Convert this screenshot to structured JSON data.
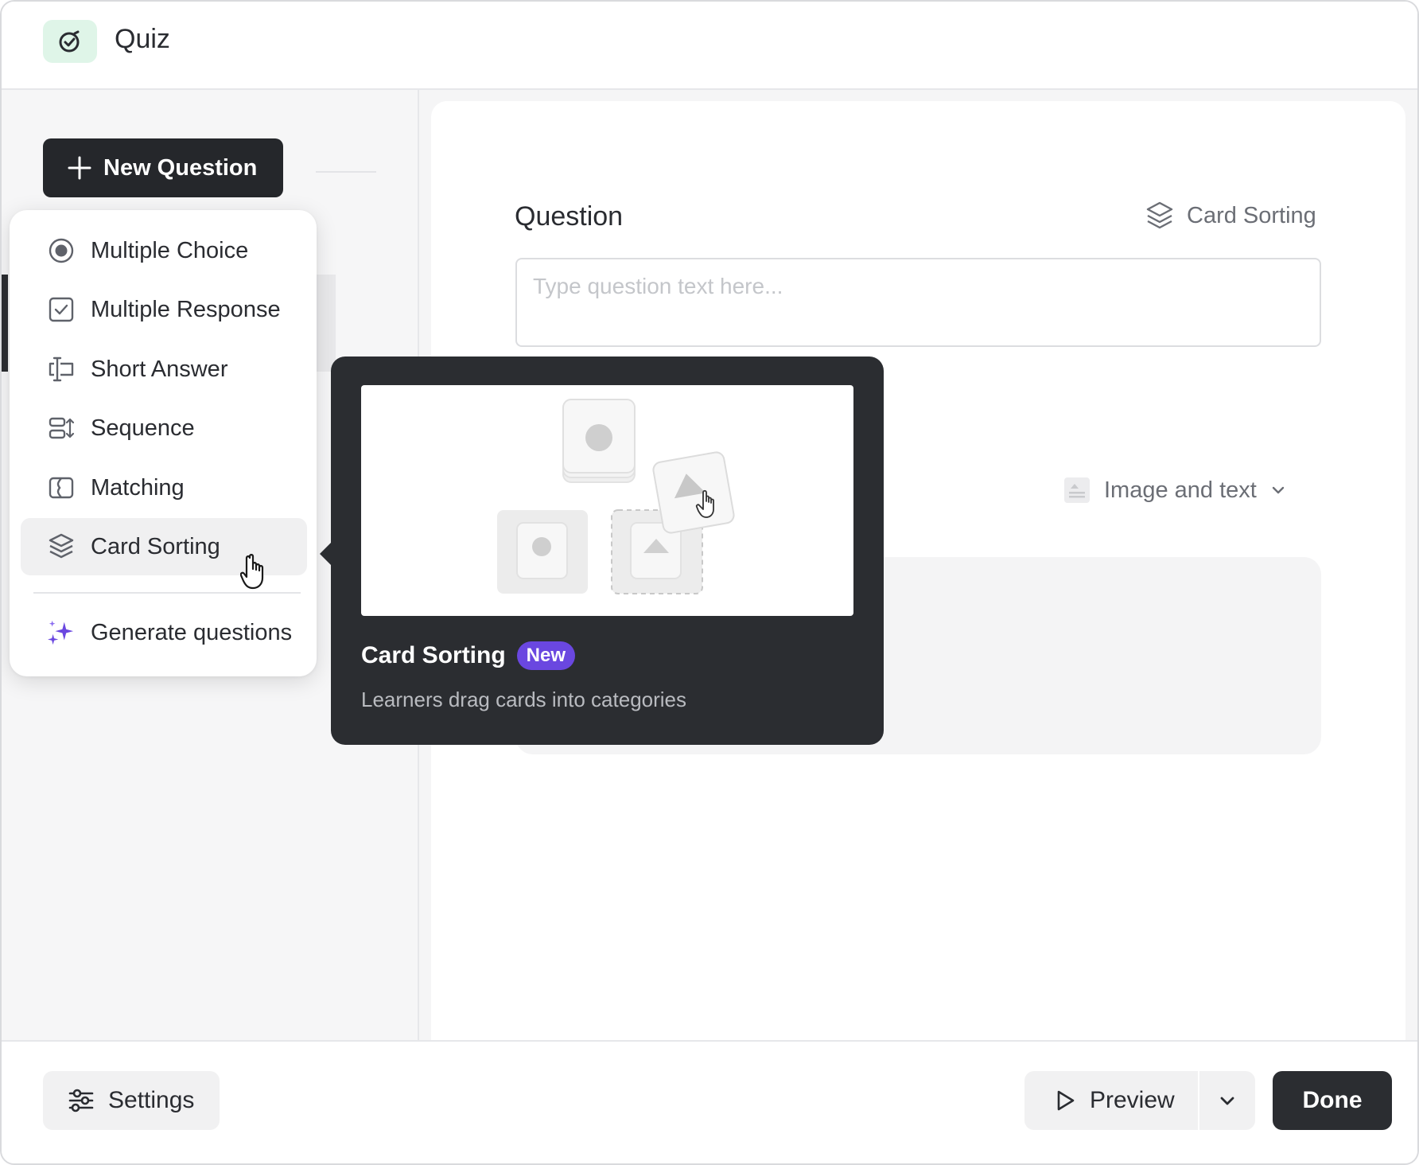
{
  "app": {
    "title": "Quiz",
    "icon": "check-circle-icon",
    "accent_badge_color": "#dff5e8"
  },
  "sidebar": {
    "new_question_label": "New Question"
  },
  "menu": {
    "items": [
      {
        "label": "Multiple Choice",
        "icon": "radio-icon"
      },
      {
        "label": "Multiple Response",
        "icon": "checkbox-icon"
      },
      {
        "label": "Short Answer",
        "icon": "text-cursor-icon"
      },
      {
        "label": "Sequence",
        "icon": "sequence-icon"
      },
      {
        "label": "Matching",
        "icon": "matching-icon"
      },
      {
        "label": "Card Sorting",
        "icon": "layers-icon",
        "active": true
      }
    ],
    "generate_label": "Generate questions",
    "generate_icon": "sparkle-icon",
    "generate_icon_color": "#6a47e0"
  },
  "editor": {
    "question_label": "Question",
    "question_type_label": "Card Sorting",
    "question_placeholder": "Type question text here...",
    "layout_label": "Image and text"
  },
  "tooltip": {
    "title": "Card Sorting",
    "badge": "New",
    "badge_color": "#6a47e0",
    "description": "Learners drag cards into categories"
  },
  "footer": {
    "settings_label": "Settings",
    "preview_label": "Preview",
    "done_label": "Done"
  }
}
